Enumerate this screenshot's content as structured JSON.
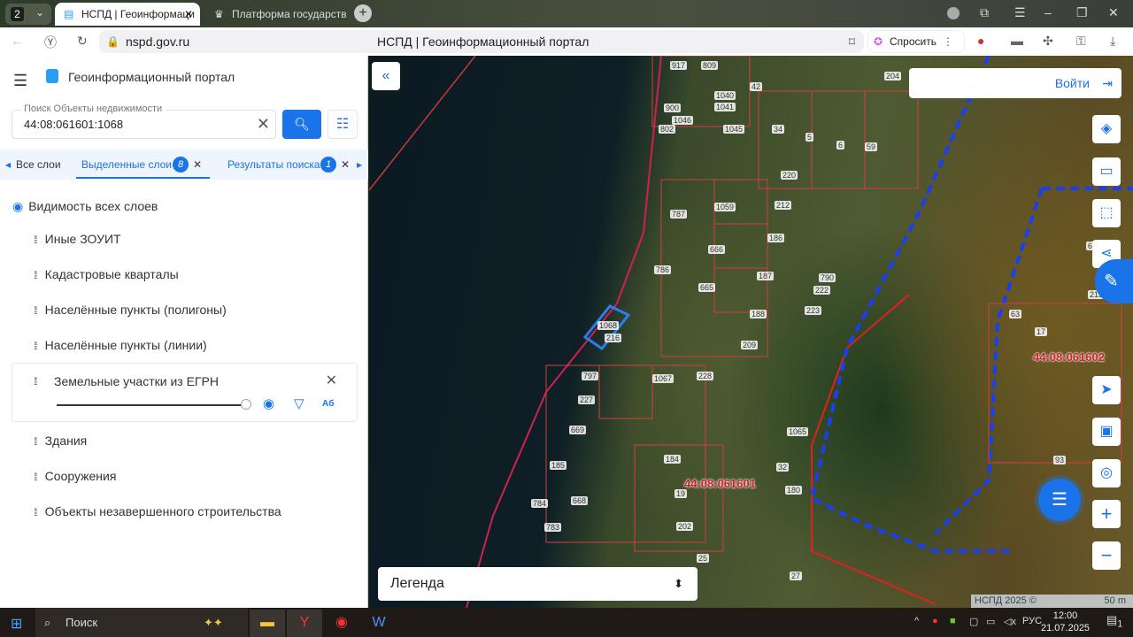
{
  "browser": {
    "tab_count": "2",
    "tabs": [
      {
        "label": "НСПД | Геоинформаци",
        "active": true
      },
      {
        "label": "Платформа государствен",
        "active": false
      }
    ],
    "url": "nspd.gov.ru",
    "page_title": "НСПД | Геоинформационный портал",
    "ask_label": "Спросить"
  },
  "sidebar": {
    "title": "Геоинформационный портал",
    "search": {
      "label": "Поиск Объекты недвижимости",
      "value": "44:08:061601:1068"
    },
    "tabs": [
      {
        "label": "Все слои"
      },
      {
        "label": "Выделенные слои",
        "count": "8"
      },
      {
        "label": "Результаты поиска",
        "count": "1"
      }
    ],
    "visibility_label": "Видимость всех слоев",
    "layers": [
      "Иные ЗОУИТ",
      "Кадастровые кварталы",
      "Населённые пункты (полигоны)",
      "Населённые пункты (линии)",
      "Земельные участки из ЕГРН",
      "Здания",
      "Сооружения",
      "Объекты незавершенного строительства"
    ],
    "expanded_layer_opacity": 1.0
  },
  "map": {
    "login_label": "Войти",
    "legend_label": "Легенда",
    "copyright": "НСПД 2025 ©",
    "scale": "50 m",
    "quarters": [
      "44:08:061601",
      "44:08:061602"
    ],
    "parcels": [
      "917",
      "809",
      "1040",
      "1041",
      "1046",
      "1045",
      "900",
      "802",
      "42",
      "34",
      "5",
      "6",
      "59",
      "204",
      "220",
      "787",
      "1059",
      "212",
      "186",
      "666",
      "187",
      "786",
      "665",
      "790",
      "222",
      "223",
      "188",
      "209",
      "1068",
      "216",
      "797",
      "1067",
      "228",
      "227",
      "669",
      "185",
      "184",
      "1065",
      "32",
      "180",
      "19",
      "784",
      "668",
      "783",
      "202",
      "25",
      "27",
      "64",
      "63",
      "17",
      "215",
      "93"
    ]
  },
  "taskbar": {
    "search_label": "Поиск",
    "lang": "РУС",
    "time": "12:00",
    "date": "21.07.2025",
    "notifications": "1"
  }
}
